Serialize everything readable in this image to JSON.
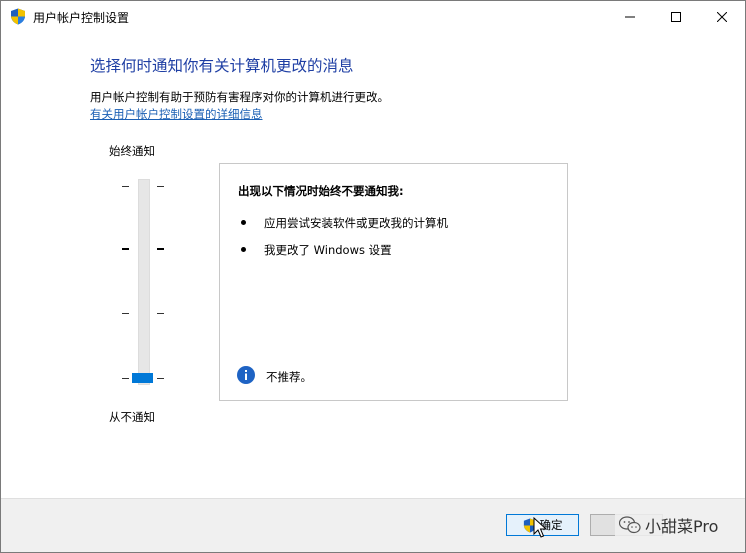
{
  "window": {
    "title": "用户帐户控制设置"
  },
  "main": {
    "heading": "选择何时通知你有关计算机更改的消息",
    "description": "用户帐户控制有助于预防有害程序对你的计算机进行更改。",
    "link": "有关用户帐户控制设置的详细信息"
  },
  "slider": {
    "top_label": "始终通知",
    "bottom_label": "从不通知",
    "levels": 4,
    "selected_level": 1
  },
  "info_box": {
    "title": "出现以下情况时始终不要通知我:",
    "bullets": [
      "应用尝试安装软件或更改我的计算机",
      "我更改了 Windows 设置"
    ],
    "note": "不推荐。"
  },
  "footer": {
    "ok_label": "确定"
  },
  "watermark": {
    "text": "小甜菜Pro"
  },
  "colors": {
    "accent": "#0078d7",
    "heading": "#1f3fa4",
    "link": "#1a5fb4"
  }
}
